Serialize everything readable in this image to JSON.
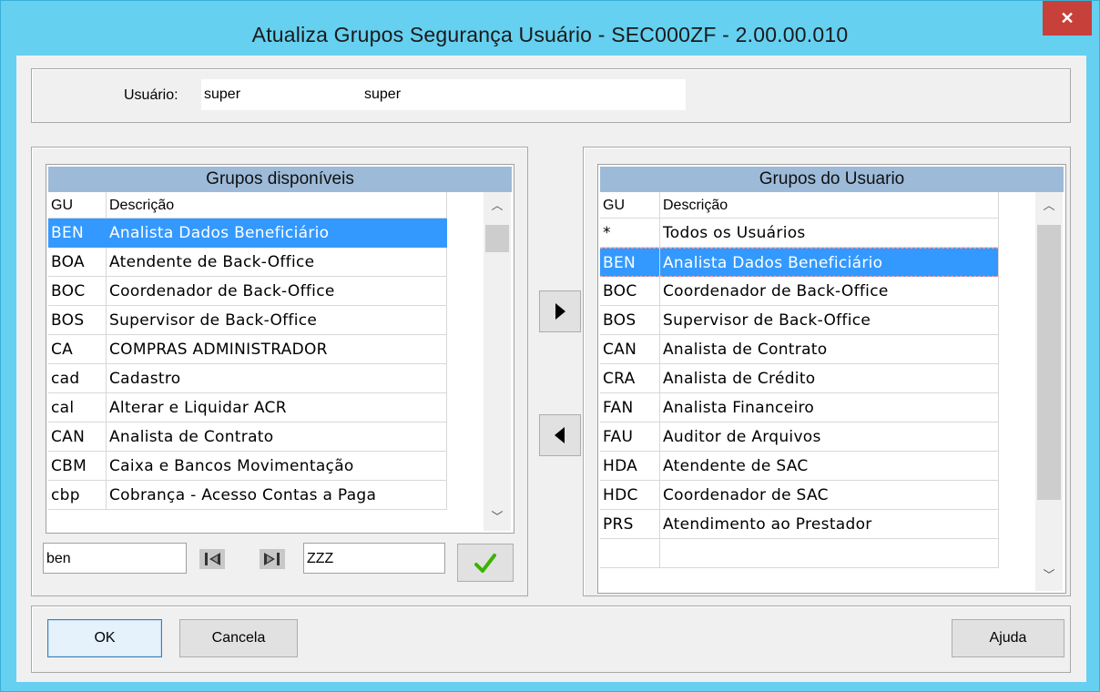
{
  "window": {
    "title": "Atualiza Grupos Segurança Usuário - SEC000ZF - 2.00.00.010",
    "close_glyph": "✕"
  },
  "user": {
    "label": "Usuário:",
    "code": "super",
    "name": "super"
  },
  "available": {
    "header": "Grupos disponíveis",
    "col_gu": "GU",
    "col_desc": "Descrição",
    "rows": [
      {
        "gu": "BEN",
        "desc": "Analista Dados Beneficiário"
      },
      {
        "gu": "BOA",
        "desc": "Atendente de Back-Office"
      },
      {
        "gu": "BOC",
        "desc": "Coordenador de Back-Office"
      },
      {
        "gu": "BOS",
        "desc": "Supervisor de Back-Office"
      },
      {
        "gu": "CA",
        "desc": "COMPRAS ADMINISTRADOR"
      },
      {
        "gu": "cad",
        "desc": "Cadastro"
      },
      {
        "gu": "cal",
        "desc": "Alterar e Liquidar ACR"
      },
      {
        "gu": "CAN",
        "desc": "Analista de Contrato"
      },
      {
        "gu": "CBM",
        "desc": "Caixa e Bancos Movimentação"
      },
      {
        "gu": "cbp",
        "desc": "Cobrança - Acesso Contas a Paga"
      }
    ],
    "filter_start": "ben",
    "filter_end": "ZZZ",
    "first_icon": "skip-first-icon",
    "last_icon": "skip-last-icon",
    "apply_icon": "checkmark-icon"
  },
  "user_groups": {
    "header": "Grupos do Usuario",
    "col_gu": "GU",
    "col_desc": "Descrição",
    "rows": [
      {
        "gu": "*",
        "desc": "Todos os Usuários"
      },
      {
        "gu": "BEN",
        "desc": "Analista Dados Beneficiário"
      },
      {
        "gu": "BOC",
        "desc": "Coordenador de Back-Office"
      },
      {
        "gu": "BOS",
        "desc": "Supervisor de Back-Office"
      },
      {
        "gu": "CAN",
        "desc": "Analista de Contrato"
      },
      {
        "gu": "CRA",
        "desc": "Analista de Crédito"
      },
      {
        "gu": "FAN",
        "desc": "Analista Financeiro"
      },
      {
        "gu": "FAU",
        "desc": "Auditor de Arquivos"
      },
      {
        "gu": "HDA",
        "desc": "Atendente de SAC"
      },
      {
        "gu": "HDC",
        "desc": "Coordenador de SAC"
      },
      {
        "gu": "PRS",
        "desc": "Atendimento ao Prestador"
      },
      {
        "gu": "",
        "desc": ""
      }
    ]
  },
  "move": {
    "add_icon": "arrow-right-icon",
    "remove_icon": "arrow-left-icon"
  },
  "buttons": {
    "ok": "OK",
    "cancel": "Cancela",
    "help": "Ajuda"
  },
  "colors": {
    "title_bar": "#65d0f0",
    "selection": "#3399ff",
    "panel_header": "#9dbbd8",
    "close_button": "#c8403a"
  }
}
